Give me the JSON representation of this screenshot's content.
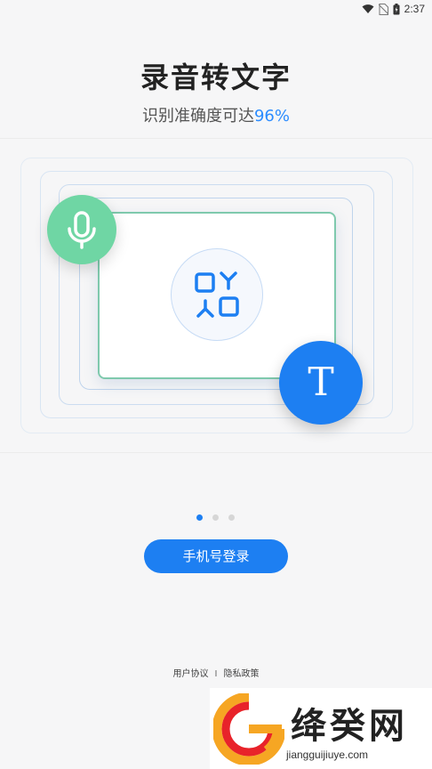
{
  "status_bar": {
    "time": "2:37"
  },
  "header": {
    "title": "录音转文字",
    "subtitle_prefix": "识别准确度可达",
    "subtitle_accent": "96%"
  },
  "illustration": {
    "t_letter": "T"
  },
  "pager": {
    "active_index": 0,
    "count": 3
  },
  "login": {
    "label": "手机号登录"
  },
  "footer": {
    "user_agreement": "用户协议",
    "separator": "I",
    "privacy_policy": "隐私政策"
  },
  "watermark": {
    "text": "绛癸网",
    "url": "jiangguijiuye.com"
  },
  "colors": {
    "accent": "#1d7ff2",
    "mic_green": "#6fd6a4",
    "background": "#f6f6f7"
  }
}
